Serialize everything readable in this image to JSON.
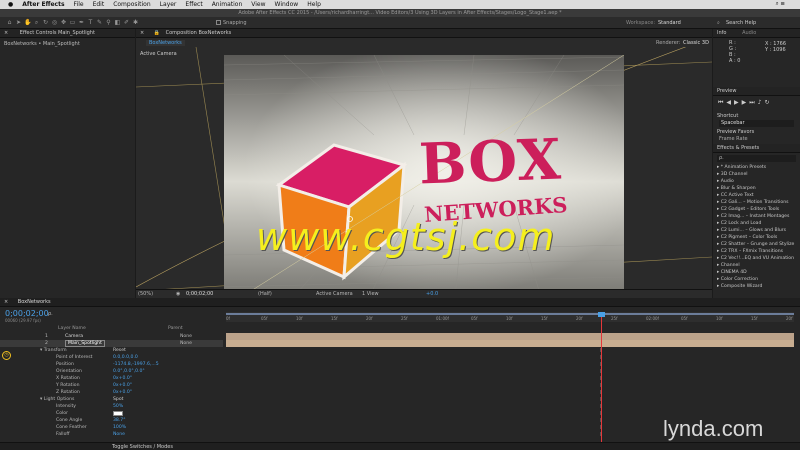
{
  "menubar": {
    "apple_icon": "",
    "app_name": "After Effects",
    "items": [
      "File",
      "Edit",
      "Composition",
      "Layer",
      "Effect",
      "Animation",
      "View",
      "Window",
      "Help"
    ],
    "right": "⌕ ≡"
  },
  "titlebar": {
    "text": "Adobe After Effects CC 2015 - /Users/richardharringt... Video Editors/3 Using 3D Layers in After Effects/Stages/Logo_Stage1.aep *"
  },
  "toolbar": {
    "snapping": "Snapping",
    "workspace_label": "Workspace:",
    "workspace_value": "Standard",
    "search_help": "Search Help"
  },
  "effects_controls": {
    "tab": "Effect Controls Main_Spotlight",
    "breadcrumb": "BoxNetworks • Main_Spotlight"
  },
  "composition": {
    "tab": "Composition BoxNetworks",
    "subtab": "BoxNetworks",
    "renderer_label": "Renderer:",
    "renderer_value": "Classic 3D",
    "view_label": "Active Camera",
    "logo_line1": "BOX",
    "logo_line2": "NETWORKS",
    "watermark": "www.cgtsj.com",
    "footer": {
      "zoom": "(50%)",
      "timecode": "0;00;02;00",
      "resolution": "(Half)",
      "camera": "Active Camera",
      "views": "1 View",
      "exposure": "+0.0"
    }
  },
  "info": {
    "tab": "Info",
    "audio_tab": "Audio",
    "r": "R :",
    "g": "G :",
    "b": "B :",
    "a": "A : 0",
    "x": "X : 1766",
    "y": "Y : 1096"
  },
  "preview": {
    "tab": "Preview",
    "shortcut_label": "Shortcut",
    "shortcut_value": "Spacebar",
    "favors_label": "Preview Favors",
    "frame_rate": "Frame Rate"
  },
  "effects_presets": {
    "tab": "Effects & Presets",
    "search": "ρ.",
    "items": [
      "▸ * Animation Presets",
      "▸ 3D Channel",
      "▸ Audio",
      "▸ Blur & Sharpen",
      "▸ CC Active Text",
      "▸ C2 Gali... – Motion Transitions",
      "▸ C2 Gadget – Editors Tools",
      "▸ C2 Imag... – Instant Montages",
      "▸ C2 Lock and Load",
      "▸ C2 Lumi... – Glows and Blurs",
      "▸ C2 Pigment – Color Tools",
      "▸ C2 Shatter – Grunge and Stylize",
      "▸ C2 TRX – FXmix Transitions",
      "▸ C2 Vec!!...EQ and VU Animation",
      "▸ Channel",
      "▸ CINEMA 4D",
      "▸ Color Correction",
      "▸ Composite Wizard"
    ]
  },
  "timeline": {
    "tab": "BoxNetworks",
    "timecode": "0;00;02;00",
    "timecode_sub": "00060 (29.97 fps)",
    "search": "ρ.",
    "col_layer": "Layer Name",
    "col_parent": "Parent",
    "ruler": [
      "0f",
      "05f",
      "10f",
      "15f",
      "20f",
      "25f",
      "01:00f",
      "05f",
      "10f",
      "15f",
      "20f",
      "25f",
      "02:00f",
      "05f",
      "10f",
      "15f",
      "20f"
    ],
    "rows": [
      {
        "num": "1",
        "name": "Camera",
        "parent": "None"
      },
      {
        "num": "2",
        "name": "Main_Spotlight",
        "parent": "None"
      }
    ],
    "props": [
      {
        "label": "▾ Transform",
        "value": "Reset"
      },
      {
        "label": "Point of Interest",
        "value": "0.0,0.0,0.0"
      },
      {
        "label": "Position",
        "value": "-1174.8,-1997.6,...5"
      },
      {
        "label": "Orientation",
        "value": "0.0°,0.0°,0.0°"
      },
      {
        "label": "X Rotation",
        "value": "0x+0.0°"
      },
      {
        "label": "Y Rotation",
        "value": "0x+0.0°"
      },
      {
        "label": "Z Rotation",
        "value": "0x+0.0°"
      },
      {
        "label": "▾ Light Options",
        "value": "Spot"
      },
      {
        "label": "Intensity",
        "value": "50%"
      },
      {
        "label": "Color",
        "value": ""
      },
      {
        "label": "Cone Angle",
        "value": "38.7°"
      },
      {
        "label": "Cone Feather",
        "value": "100%"
      },
      {
        "label": "Falloff",
        "value": "None"
      }
    ],
    "toggle": "Toggle Switches / Modes",
    "watermark": "lynda.com"
  },
  "colors": {
    "accent": "#4aa0e6",
    "cube_top": "#d81e65",
    "cube_side": "#f07d18",
    "logo": "#cc1f5b",
    "watermark": "#f5ef1e",
    "timeline_bar": "#bba28a",
    "playhead": "#e5373a"
  }
}
